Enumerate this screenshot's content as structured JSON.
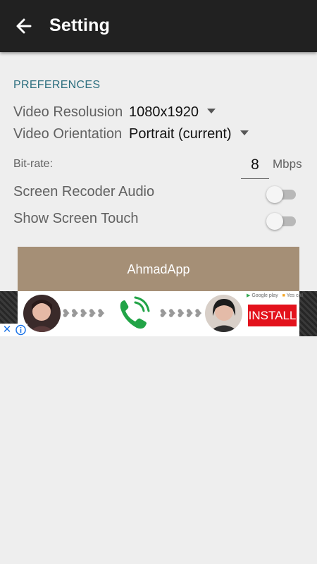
{
  "appbar": {
    "title": "Setting",
    "icon": "arrow-left-icon"
  },
  "preferences": {
    "header": "PREFERENCES",
    "video_resolution": {
      "label": "Video Resolusion",
      "value": "1080x1920"
    },
    "video_orientation": {
      "label": "Video Orientation",
      "value": "Portrait (current)"
    },
    "bitrate": {
      "label": "Bit-rate:",
      "value": "8",
      "unit": "Mbps"
    },
    "screen_audio": {
      "label": "Screen Recoder Audio",
      "enabled": false
    },
    "show_touch": {
      "label": "Show Screen Touch",
      "enabled": false
    }
  },
  "banner": {
    "text": "AhmadApp"
  },
  "ad": {
    "store_text": "Google play",
    "store_text2": "Yes call",
    "install_label": "INSTALL",
    "close_label": "✕"
  },
  "colors": {
    "appbar": "#212121",
    "accent_header": "#2b6e7e",
    "banner": "#a58f76",
    "install": "#e3121c"
  }
}
